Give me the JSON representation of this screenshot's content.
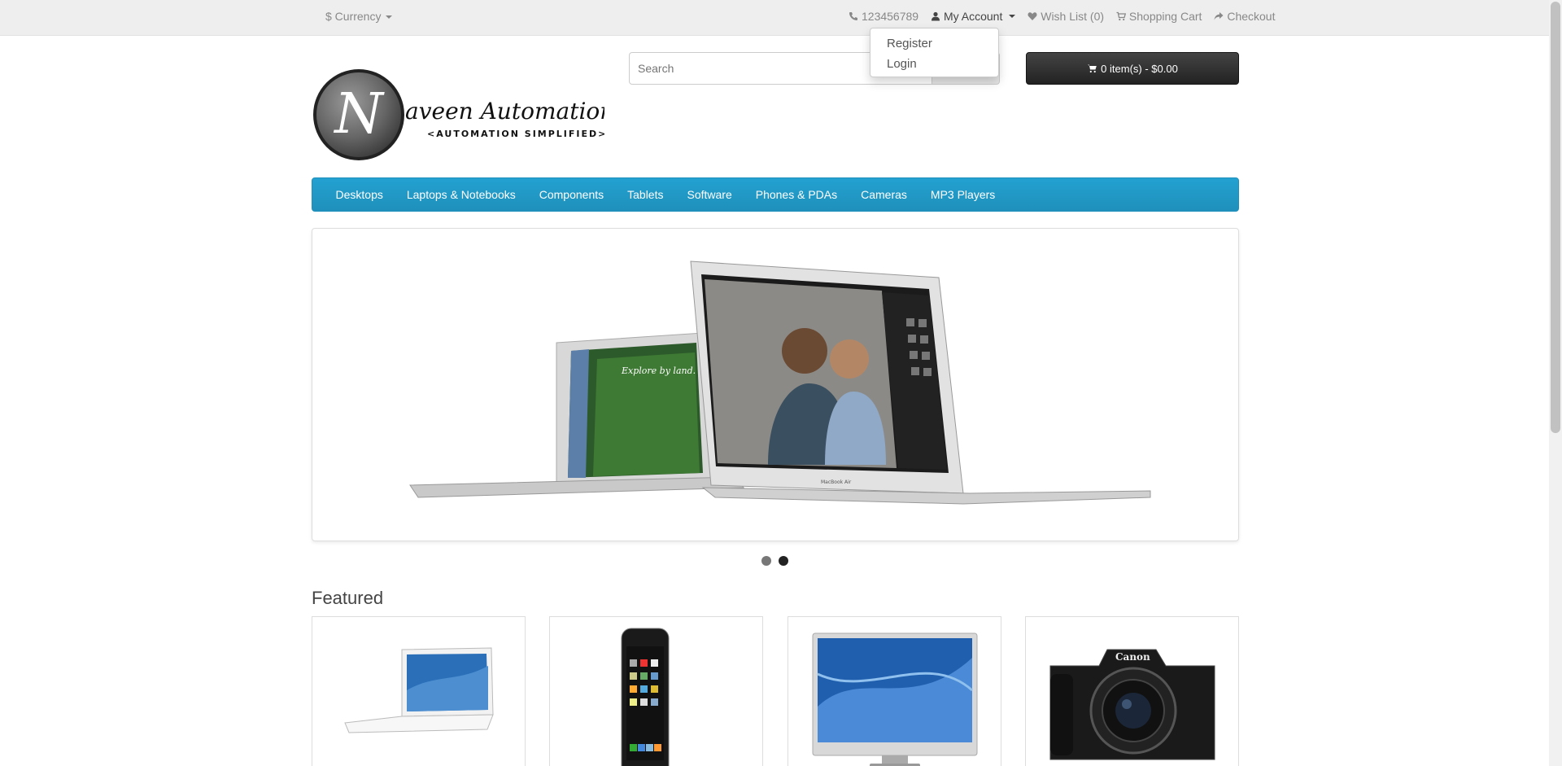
{
  "topbar": {
    "currency_label": "$ Currency",
    "phone": "123456789",
    "my_account": "My Account",
    "wishlist": "Wish List (0)",
    "shopping_cart": "Shopping Cart",
    "checkout": "Checkout"
  },
  "account_menu": {
    "items": [
      "Register",
      "Login"
    ]
  },
  "logo": {
    "letter": "N",
    "name": "aveen Automation Labs",
    "tagline": "<AUTOMATION SIMPLIFIED>"
  },
  "search": {
    "placeholder": "Search"
  },
  "cart": {
    "label": "0 item(s) - $0.00"
  },
  "menu": {
    "items": [
      "Desktops",
      "Laptops & Notebooks",
      "Components",
      "Tablets",
      "Software",
      "Phones & PDAs",
      "Cameras",
      "MP3 Players"
    ]
  },
  "slideshow": {
    "screen_text": "Explore by land.",
    "laptop_brand": "MacBook Air",
    "active_slide": 2,
    "slide_count": 2
  },
  "featured": {
    "title": "Featured",
    "camera_brand": "Canon"
  },
  "colors": {
    "menu_blue": "#229ac8",
    "cart_dark": "#303030",
    "topbar": "#eeeeee"
  }
}
